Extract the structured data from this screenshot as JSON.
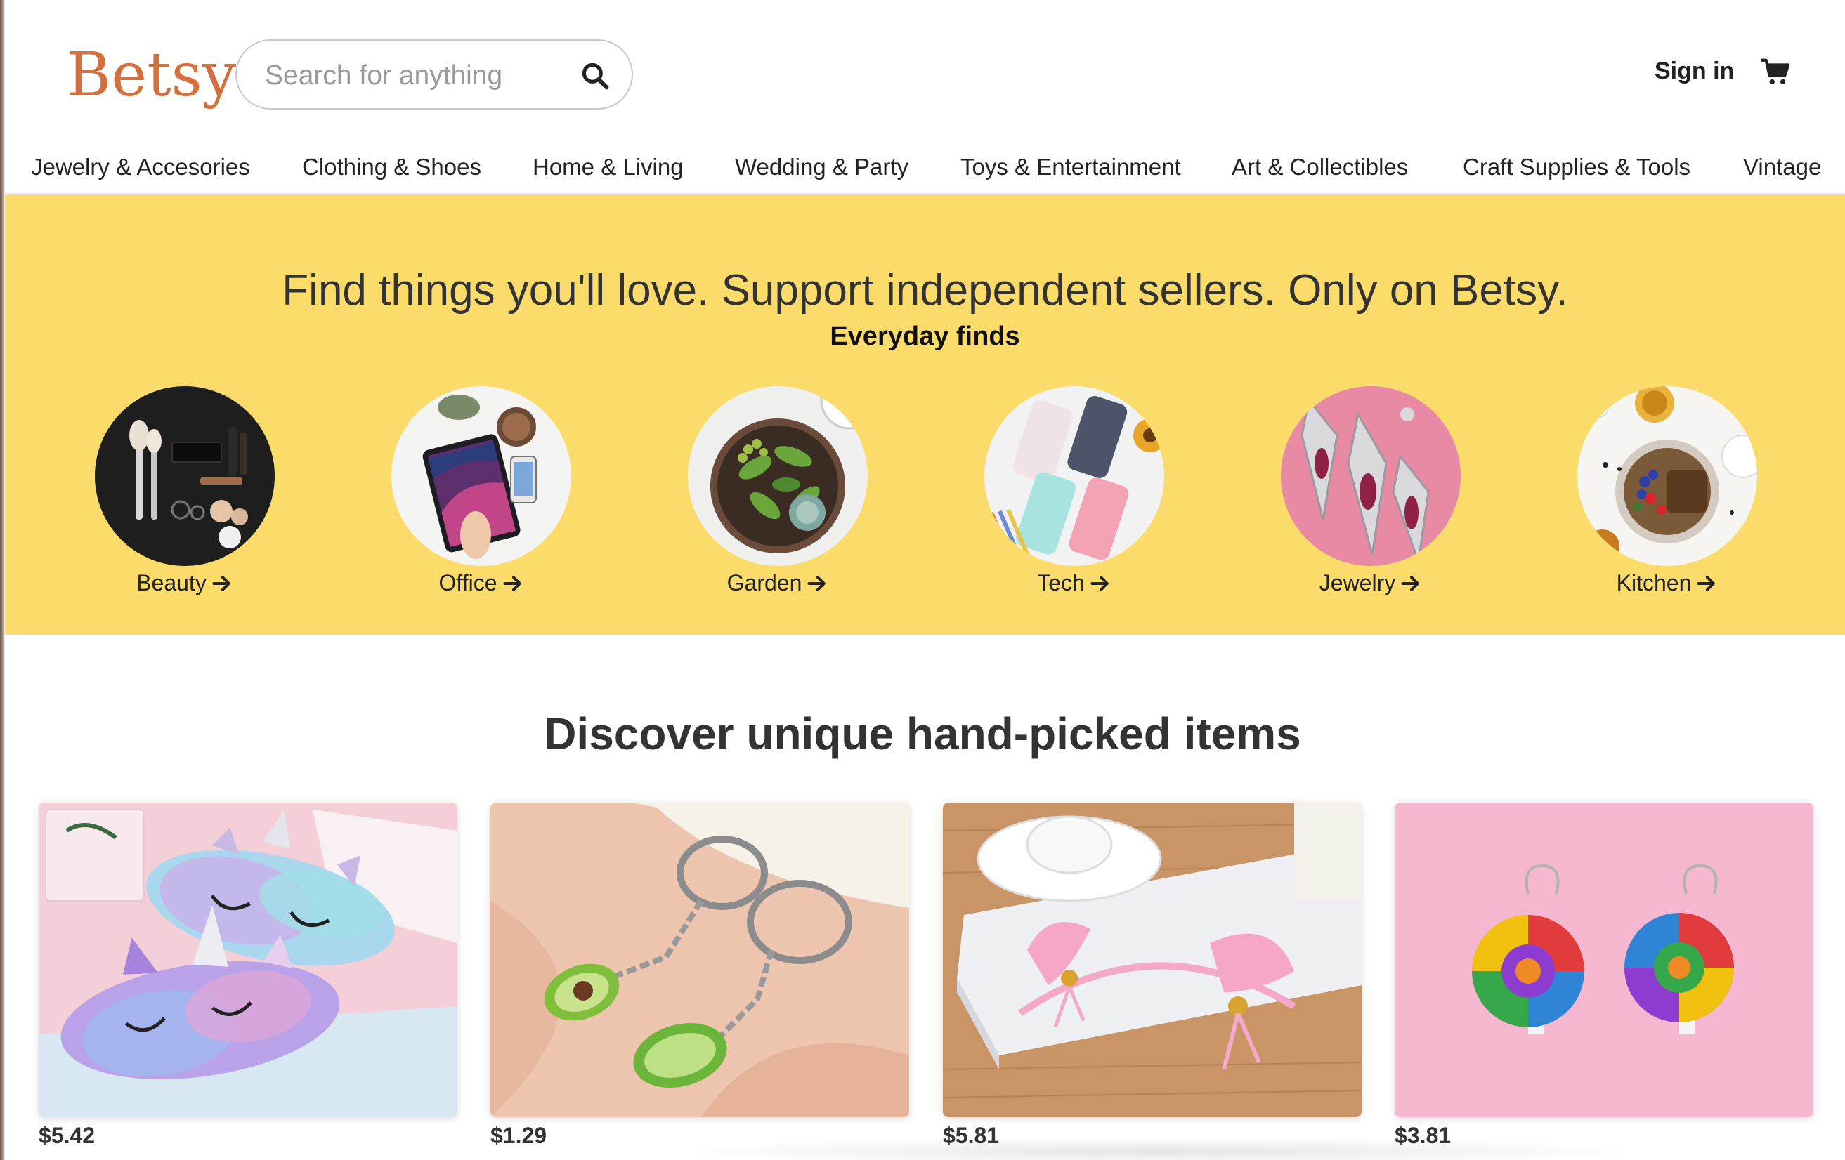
{
  "header": {
    "logo": "Betsy",
    "search_placeholder": "Search for anything",
    "signin_label": "Sign in",
    "icons": {
      "search": "search-icon",
      "cart": "cart-icon"
    }
  },
  "categories": [
    "Jewelry & Accesories",
    "Clothing & Shoes",
    "Home & Living",
    "Wedding & Party",
    "Toys & Entertainment",
    "Art & Collectibles",
    "Craft Supplies & Tools",
    "Vintage"
  ],
  "hero": {
    "title": "Find things you'll love. Support independent sellers. Only on Betsy.",
    "subtitle": "Everyday finds",
    "background_color": "#fbdc6a",
    "items": [
      {
        "label": "Beauty",
        "image": "beauty-photo"
      },
      {
        "label": "Office",
        "image": "office-photo"
      },
      {
        "label": "Garden",
        "image": "garden-photo"
      },
      {
        "label": "Tech",
        "image": "tech-photo"
      },
      {
        "label": "Jewelry",
        "image": "jewelry-photo"
      },
      {
        "label": "Kitchen",
        "image": "kitchen-photo"
      }
    ]
  },
  "discover": {
    "title": "Discover unique hand-picked items",
    "products": [
      {
        "price": "$5.42",
        "image": "unicorn-sleep-masks-photo"
      },
      {
        "price": "$1.29",
        "image": "avocado-keychains-photo"
      },
      {
        "price": "$5.81",
        "image": "cat-ear-headband-photo"
      },
      {
        "price": "$3.81",
        "image": "lollipop-earrings-photo"
      }
    ]
  },
  "colors": {
    "logo": "#d4703d",
    "hero": "#fbdc6a",
    "text": "#222222"
  }
}
